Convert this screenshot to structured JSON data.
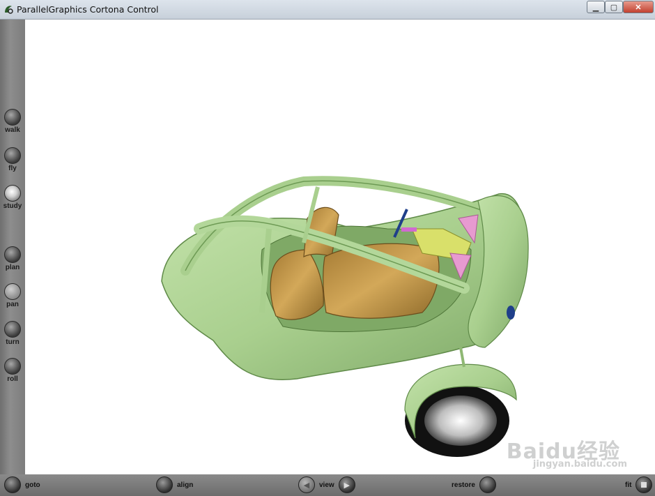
{
  "window": {
    "title": "ParallelGraphics Cortona Control",
    "min_icon": "minimize-icon",
    "max_icon": "maximize-icon",
    "close_icon": "close-icon"
  },
  "left_toolbar": {
    "items": [
      {
        "label": "walk",
        "icon": "walk-icon",
        "active": false
      },
      {
        "label": "fly",
        "icon": "fly-icon",
        "active": false
      },
      {
        "label": "study",
        "icon": "study-icon",
        "active": true
      },
      {
        "label": "plan",
        "icon": "plan-icon",
        "active": false
      },
      {
        "label": "pan",
        "icon": "pan-icon",
        "active": false
      },
      {
        "label": "turn",
        "icon": "turn-icon",
        "active": false
      },
      {
        "label": "roll",
        "icon": "roll-icon",
        "active": false
      }
    ]
  },
  "bottom_toolbar": {
    "goto_label": "goto",
    "align_label": "align",
    "view_label": "view",
    "restore_label": "restore",
    "fit_label": "fit"
  },
  "watermark": {
    "logo": "Baidu经验",
    "url": "jingyan.baidu.com"
  },
  "colors": {
    "body_green": "#a9cf8e",
    "seat_tan": "#c79a4a",
    "steering_yellow": "#d9e06a",
    "pedal_pink": "#e79ad0",
    "viewport_bg": "#ffffff",
    "toolbar_gray": "#8a8a8a"
  }
}
